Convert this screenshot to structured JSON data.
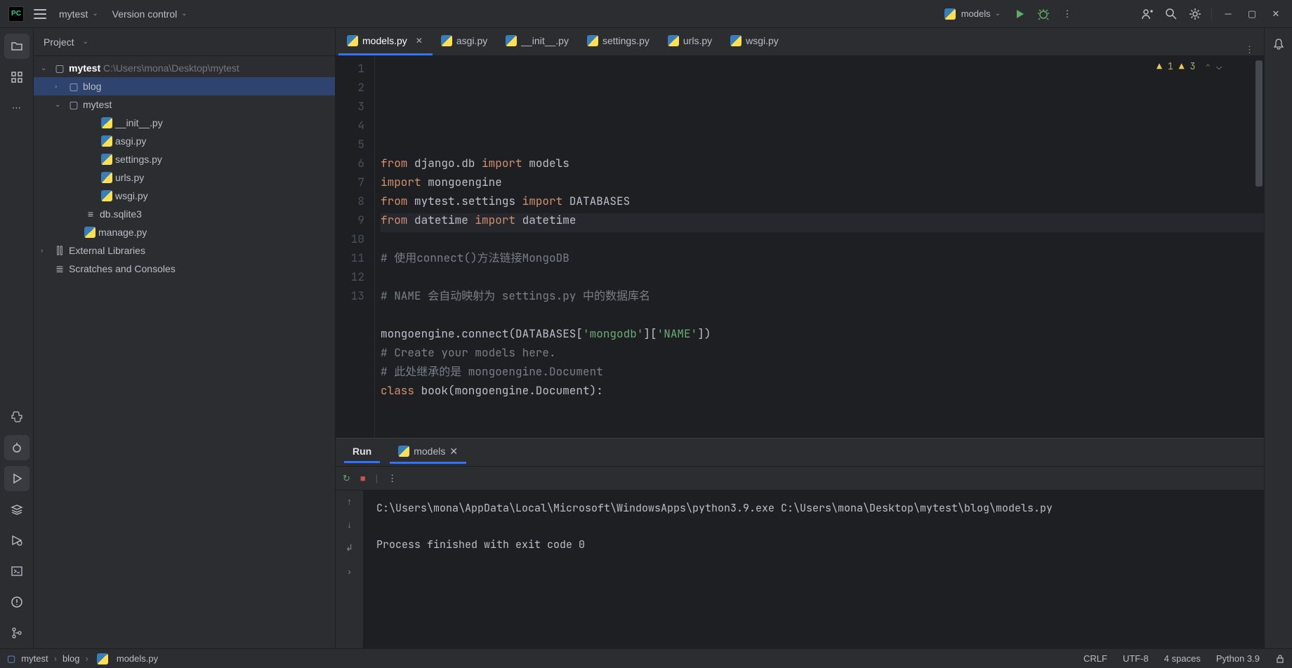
{
  "topbar": {
    "project_menu_label": "mytest",
    "version_control_label": "Version control",
    "run_config_label": "models"
  },
  "project_panel": {
    "header_label": "Project",
    "tree": {
      "root_name": "mytest",
      "root_path": "C:\\Users\\mona\\Desktop\\mytest",
      "blog": "blog",
      "mytest_pkg": "mytest",
      "files": {
        "init": "__init__.py",
        "asgi": "asgi.py",
        "settings": "settings.py",
        "urls": "urls.py",
        "wsgi": "wsgi.py"
      },
      "db": "db.sqlite3",
      "manage": "manage.py",
      "ext_lib": "External Libraries",
      "scratches": "Scratches and Consoles"
    }
  },
  "tabs": [
    {
      "label": "models.py",
      "active": true
    },
    {
      "label": "asgi.py",
      "active": false
    },
    {
      "label": "__init__.py",
      "active": false
    },
    {
      "label": "settings.py",
      "active": false
    },
    {
      "label": "urls.py",
      "active": false
    },
    {
      "label": "wsgi.py",
      "active": false
    }
  ],
  "inspection": {
    "warn1_count": "1",
    "warn2_count": "3"
  },
  "code_lines": [
    {
      "n": "1",
      "segments": [
        {
          "t": "from ",
          "c": "kw"
        },
        {
          "t": "django.db "
        },
        {
          "t": "import ",
          "c": "kw"
        },
        {
          "t": "models"
        }
      ]
    },
    {
      "n": "2",
      "segments": [
        {
          "t": "import ",
          "c": "kw"
        },
        {
          "t": "mongoengine"
        }
      ]
    },
    {
      "n": "3",
      "segments": [
        {
          "t": "from ",
          "c": "kw"
        },
        {
          "t": "mytest.settings "
        },
        {
          "t": "import ",
          "c": "kw"
        },
        {
          "t": "DATABASES"
        }
      ]
    },
    {
      "n": "4",
      "segments": [
        {
          "t": "from ",
          "c": "kw"
        },
        {
          "t": "datetime "
        },
        {
          "t": "import ",
          "c": "kw"
        },
        {
          "t": "datetime"
        }
      ]
    },
    {
      "n": "5",
      "segments": []
    },
    {
      "n": "6",
      "segments": [
        {
          "t": "# 使用connect()方法链接MongoDB",
          "c": "cmt"
        }
      ]
    },
    {
      "n": "7",
      "segments": []
    },
    {
      "n": "8",
      "segments": [
        {
          "t": "# NAME 会自动映射为 settings.py 中的数据库名",
          "c": "cmt"
        }
      ]
    },
    {
      "n": "9",
      "segments": []
    },
    {
      "n": "10",
      "segments": [
        {
          "t": "mongoengine.connect(DATABASES["
        },
        {
          "t": "'mongodb'",
          "c": "str"
        },
        {
          "t": "]["
        },
        {
          "t": "'NAME'",
          "c": "str"
        },
        {
          "t": "])"
        }
      ]
    },
    {
      "n": "11",
      "segments": [
        {
          "t": "# Create your models here.",
          "c": "cmt"
        }
      ]
    },
    {
      "n": "12",
      "segments": [
        {
          "t": "# 此处继承的是 mongoengine.Document",
          "c": "cmt"
        }
      ]
    },
    {
      "n": "13",
      "segments": [
        {
          "t": "class ",
          "c": "kw"
        },
        {
          "t": "book(mongoengine.Document):"
        }
      ]
    }
  ],
  "run_panel": {
    "header_label": "Run",
    "tab_label": "models",
    "output_line1": "C:\\Users\\mona\\AppData\\Local\\Microsoft\\WindowsApps\\python3.9.exe C:\\Users\\mona\\Desktop\\mytest\\blog\\models.py",
    "output_line2": "",
    "output_line3": "Process finished with exit code 0"
  },
  "statusbar": {
    "crumb1": "mytest",
    "crumb2": "blog",
    "crumb3": "models.py",
    "line_sep": "CRLF",
    "encoding": "UTF-8",
    "indent": "4 spaces",
    "interpreter": "Python 3.9"
  }
}
